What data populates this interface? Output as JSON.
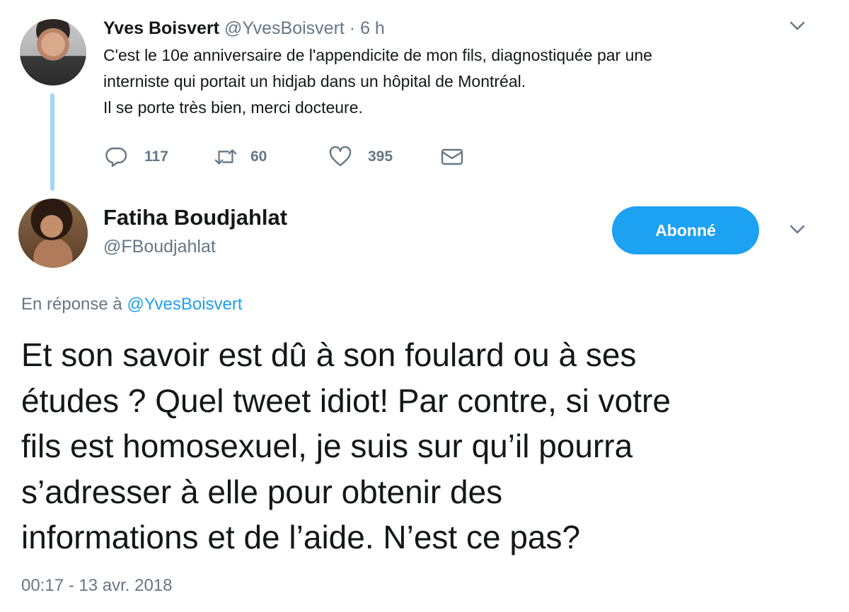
{
  "tweet1": {
    "author_name": "Yves Boisvert",
    "author_handle": "@YvesBoisvert",
    "time": "· 6 h",
    "lines": [
      "C'est le 10e anniversaire de l'appendicite de mon fils, diagnostiquée par une",
      "interniste qui portait un hidjab dans un hôpital de Montréal.",
      "Il se porte très bien, merci docteure."
    ],
    "actions": {
      "reply_count": "117",
      "retweet_count": "60",
      "like_count": "395"
    }
  },
  "tweet2": {
    "author_name": "Fatiha Boudjahlat",
    "author_handle": "@FBoudjahlat",
    "follow_label": "Abonné",
    "reply_prefix": "En réponse à",
    "reply_mention": "@YvesBoisvert",
    "lines": [
      "Et son savoir est dû à son foulard ou à ses",
      "études ? Quel tweet idiot! Par contre, si votre",
      "fils est homosexuel, je suis sur qu’il pourra",
      "s’adresser à elle pour obtenir des",
      "informations et de l’aide. N’est ce pas?"
    ],
    "timestamp": "00:17 - 13 avr. 2018"
  },
  "icons": {
    "reply": "reply-icon",
    "retweet": "retweet-icon",
    "like": "heart-icon",
    "dm": "envelope-icon",
    "more": "chevron-down-icon"
  },
  "colors": {
    "accent": "#1da1f2",
    "secondary_text": "#657786",
    "thread_line": "#9fd6f5"
  }
}
